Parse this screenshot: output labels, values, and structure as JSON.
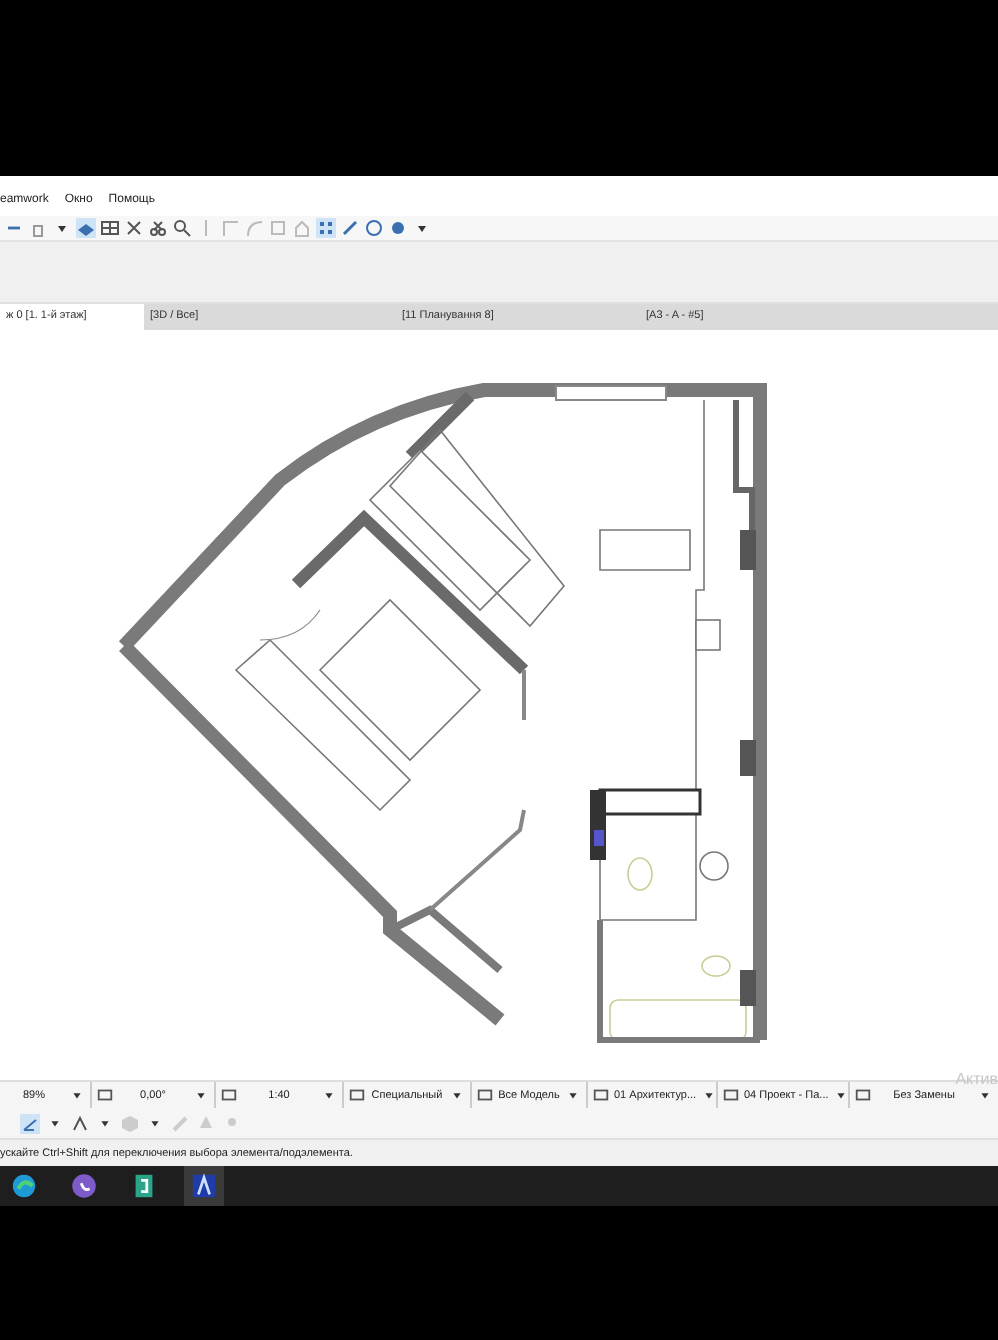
{
  "menu": [
    "eamwork",
    "Окно",
    "Помощь"
  ],
  "view_tabs": [
    {
      "label": "ж 0 [1. 1-й этаж]",
      "selected": true
    },
    {
      "label": "[3D / Все]",
      "selected": false
    },
    {
      "label": "[11 Планування 8]",
      "selected": false
    },
    {
      "label": "[A3 - A - #5]",
      "selected": false
    }
  ],
  "status_fields": [
    {
      "value": "89%"
    },
    {
      "value": "0,00°"
    },
    {
      "value": "1:40"
    },
    {
      "value": "Специальный"
    },
    {
      "value": "Все Модель"
    },
    {
      "value": "01 Архитектур..."
    },
    {
      "value": "04 Проект - Па..."
    },
    {
      "value": "Без Замены"
    }
  ],
  "hint": "ускайте Ctrl+Shift для переключения выбора элемента/подэлемента.",
  "activation_text": "Актив"
}
